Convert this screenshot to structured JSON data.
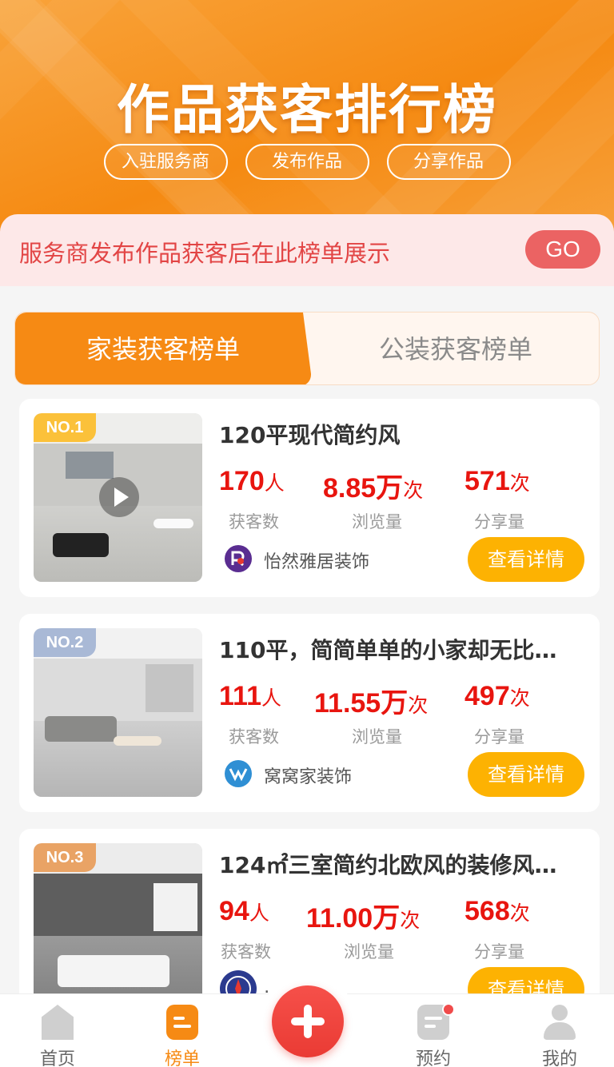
{
  "banner": {
    "title": "作品获客排行榜",
    "pills": [
      "入驻服务商",
      "发布作品",
      "分享作品"
    ]
  },
  "notice": {
    "text": "服务商发布作品获客后在此榜单展示",
    "go_label": "GO"
  },
  "tabs": {
    "active": "家装获客榜单",
    "inactive": "公装获客榜单"
  },
  "cards": [
    {
      "rank": "NO.1",
      "title": "120平现代简约风",
      "customers": "170",
      "customers_unit": "人",
      "customers_label": "获客数",
      "views": "8.85万",
      "views_unit": "次",
      "views_label": "浏览量",
      "shares": "571",
      "shares_unit": "次",
      "shares_label": "分享量",
      "company": "怡然雅居装饰",
      "detail_label": "查看详情"
    },
    {
      "rank": "NO.2",
      "title": "110平，简简单单的小家却无比…",
      "customers": "111",
      "customers_unit": "人",
      "customers_label": "获客数",
      "views": "11.55万",
      "views_unit": "次",
      "views_label": "浏览量",
      "shares": "497",
      "shares_unit": "次",
      "shares_label": "分享量",
      "company": "窝窝家装饰",
      "detail_label": "查看详情"
    },
    {
      "rank": "NO.3",
      "title": "124㎡三室简约北欧风的装修风…",
      "customers": "94",
      "customers_unit": "人",
      "customers_label": "获客数",
      "views": "11.00万",
      "views_unit": "次",
      "views_label": "浏览量",
      "shares": "568",
      "shares_unit": "次",
      "shares_label": "分享量",
      "company": "…",
      "detail_label": "查看详情"
    }
  ],
  "tabbar": {
    "home": "首页",
    "ranking": "榜单",
    "booking": "预约",
    "mine": "我的"
  },
  "colors": {
    "accent": "#f68a14",
    "red": "#e8150f",
    "button_yellow": "#fdb202"
  }
}
